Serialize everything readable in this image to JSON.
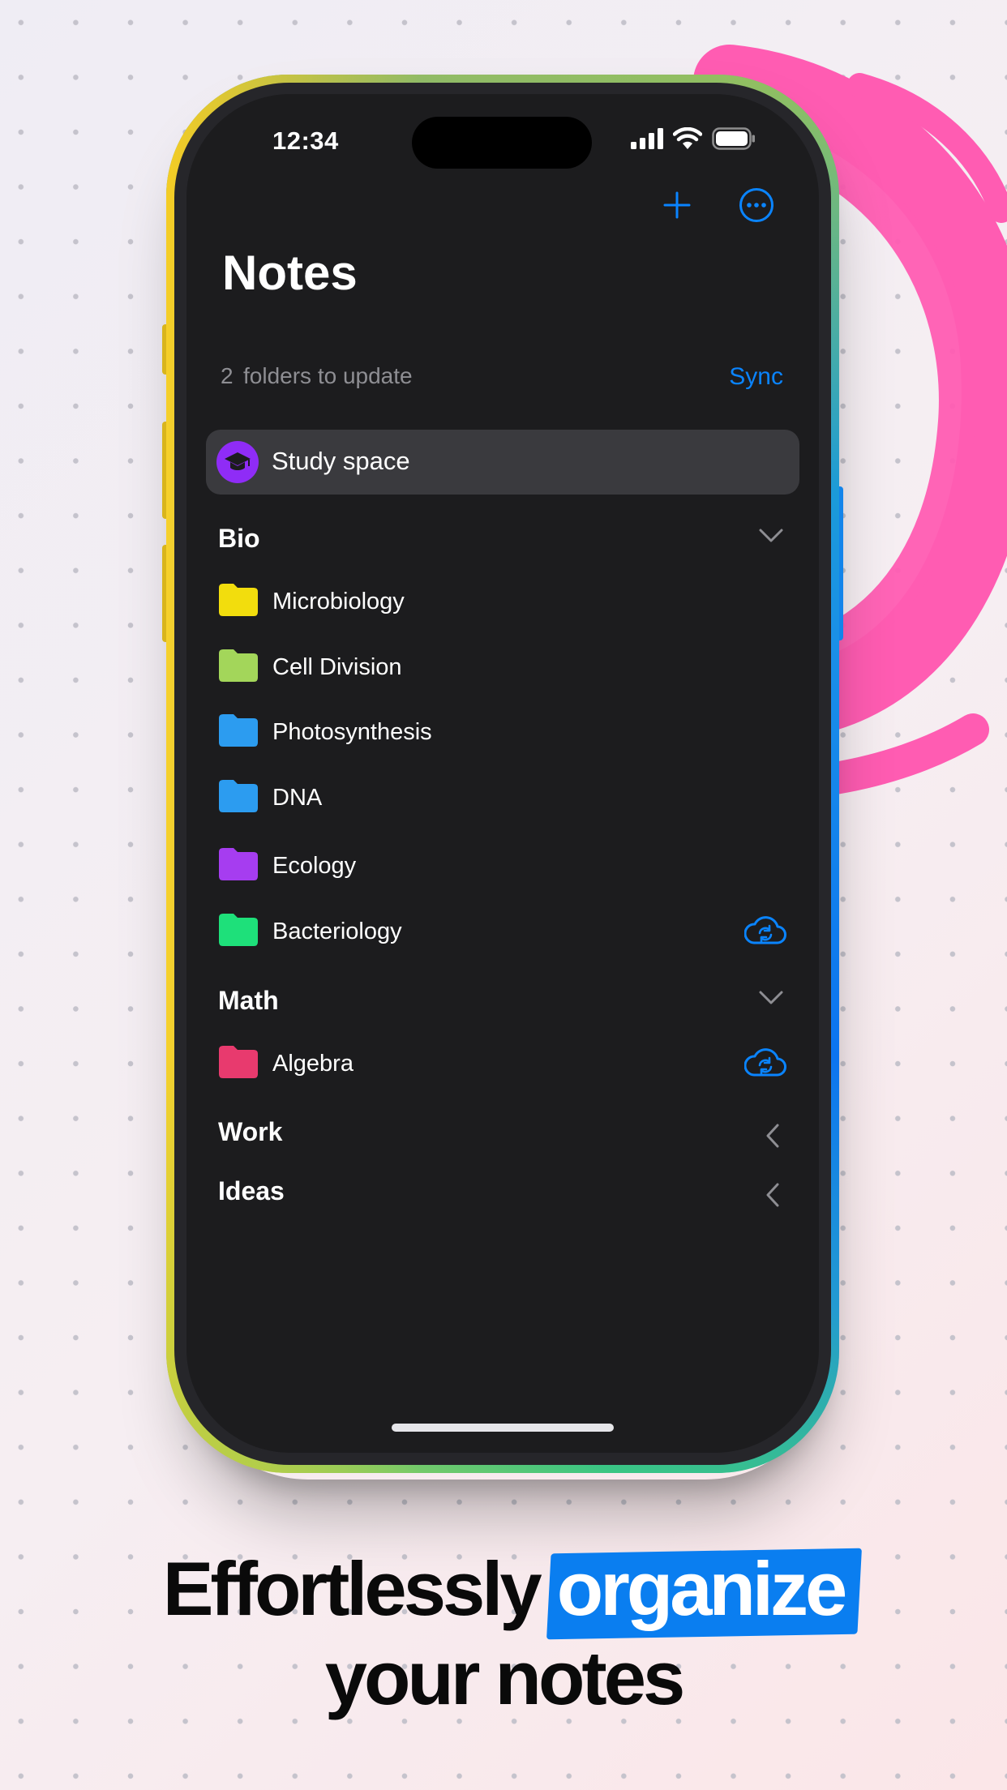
{
  "status_bar": {
    "time": "12:34"
  },
  "header": {
    "title": "Notes"
  },
  "sync_banner": {
    "count": "2",
    "text": "folders to update",
    "action": "Sync"
  },
  "study_space": {
    "label": "Study space"
  },
  "sections": [
    {
      "title": "Bio",
      "state": "expanded",
      "folders": [
        {
          "label": "Microbiology",
          "color": "#f2dd0d",
          "cloud": false
        },
        {
          "label": "Cell Division",
          "color": "#a3d65a",
          "cloud": false
        },
        {
          "label": "Photosynthesis",
          "color": "#2c9cf0",
          "cloud": false
        },
        {
          "label": "DNA",
          "color": "#2c9cf0",
          "cloud": false
        },
        {
          "label": "Ecology",
          "color": "#a63df0",
          "cloud": false
        },
        {
          "label": "Bacteriology",
          "color": "#1ee07a",
          "cloud": true
        }
      ]
    },
    {
      "title": "Math",
      "state": "expanded",
      "folders": [
        {
          "label": "Algebra",
          "color": "#e83a6e",
          "cloud": true
        }
      ]
    },
    {
      "title": "Work",
      "state": "collapsed",
      "folders": []
    },
    {
      "title": "Ideas",
      "state": "collapsed",
      "folders": []
    }
  ],
  "headline": {
    "line1_a": "Effortlessly",
    "line1_highlight": "organize",
    "line2": "your notes"
  },
  "colors": {
    "accent": "#0a84ff",
    "screen_bg": "#1c1c1e",
    "swoosh": "#ff5cb2"
  },
  "icons": [
    "signal-icon",
    "wifi-icon",
    "battery-icon",
    "plus-icon",
    "more-icon",
    "graduation-cap-icon",
    "folder-icon",
    "chevron-down-icon",
    "chevron-left-icon",
    "cloud-sync-icon"
  ]
}
